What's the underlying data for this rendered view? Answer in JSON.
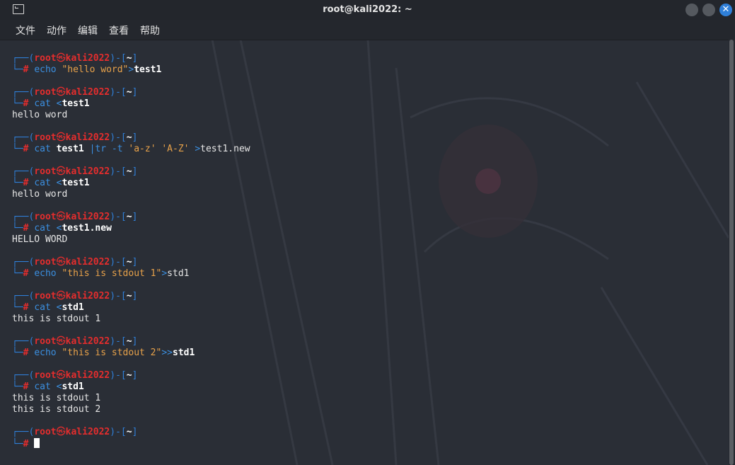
{
  "window": {
    "title": "root@kali2022: ~",
    "close_glyph": "✕"
  },
  "menu": {
    "items": [
      "文件",
      "动作",
      "编辑",
      "查看",
      "帮助"
    ]
  },
  "prompt": {
    "open": "┌──(",
    "user": "root",
    "at": "㉿",
    "host": "kali2022",
    "mid": ")-[",
    "cwd": "~",
    "close": "]",
    "second": "└─",
    "hash": "#"
  },
  "session": [
    {
      "cmd": "echo",
      "args": [
        {
          "t": " ",
          "k": "plain"
        },
        {
          "t": "\"hello word\"",
          "k": "str"
        },
        {
          "t": ">",
          "k": "op"
        },
        {
          "t": "test1",
          "k": "file"
        }
      ],
      "output": []
    },
    {
      "cmd": "cat",
      "args": [
        {
          "t": " ",
          "k": "plain"
        },
        {
          "t": "<",
          "k": "op"
        },
        {
          "t": "test1",
          "k": "file"
        }
      ],
      "output": [
        "hello word"
      ]
    },
    {
      "cmd": "cat",
      "args": [
        {
          "t": " ",
          "k": "plain"
        },
        {
          "t": "test1",
          "k": "file"
        },
        {
          "t": " ",
          "k": "plain"
        },
        {
          "t": "|",
          "k": "op"
        },
        {
          "t": "tr",
          "k": "cmd"
        },
        {
          "t": " -t ",
          "k": "cmd"
        },
        {
          "t": "'a-z'",
          "k": "str"
        },
        {
          "t": " ",
          "k": "plain"
        },
        {
          "t": "'A-Z'",
          "k": "str"
        },
        {
          "t": " ",
          "k": "plain"
        },
        {
          "t": ">",
          "k": "op"
        },
        {
          "t": "test1.new",
          "k": "plain"
        }
      ],
      "output": []
    },
    {
      "cmd": "cat",
      "args": [
        {
          "t": " ",
          "k": "plain"
        },
        {
          "t": "<",
          "k": "op"
        },
        {
          "t": "test1",
          "k": "file"
        }
      ],
      "output": [
        "hello word"
      ]
    },
    {
      "cmd": "cat",
      "args": [
        {
          "t": " ",
          "k": "plain"
        },
        {
          "t": "<",
          "k": "op"
        },
        {
          "t": "test1.new",
          "k": "file"
        }
      ],
      "output": [
        "HELLO WORD"
      ]
    },
    {
      "cmd": "echo",
      "args": [
        {
          "t": " ",
          "k": "plain"
        },
        {
          "t": "\"this is stdout 1\"",
          "k": "str"
        },
        {
          "t": ">",
          "k": "op"
        },
        {
          "t": "std1",
          "k": "plain"
        }
      ],
      "output": []
    },
    {
      "cmd": "cat",
      "args": [
        {
          "t": " ",
          "k": "plain"
        },
        {
          "t": "<",
          "k": "op"
        },
        {
          "t": "std1",
          "k": "file"
        }
      ],
      "output": [
        "this is stdout 1"
      ]
    },
    {
      "cmd": "echo",
      "args": [
        {
          "t": " ",
          "k": "plain"
        },
        {
          "t": "\"this is stdout 2\"",
          "k": "str"
        },
        {
          "t": ">>",
          "k": "op"
        },
        {
          "t": "std1",
          "k": "file"
        }
      ],
      "output": []
    },
    {
      "cmd": "cat",
      "args": [
        {
          "t": " ",
          "k": "plain"
        },
        {
          "t": "<",
          "k": "op"
        },
        {
          "t": "std1",
          "k": "file"
        }
      ],
      "output": [
        "this is stdout 1",
        "this is stdout 2"
      ]
    },
    {
      "cmd": "",
      "args": [],
      "output": [],
      "cursor": true
    }
  ],
  "colors": {
    "prompt_box": "#2f7fd8",
    "user_host": "#e52d2d",
    "command": "#3b8fe0",
    "string": "#e8a24a",
    "background": "#2a2e36"
  }
}
